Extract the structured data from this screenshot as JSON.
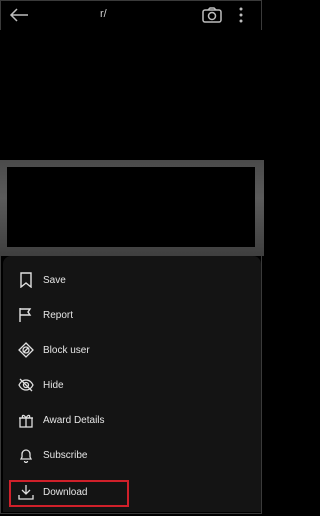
{
  "header": {
    "title": "r/",
    "icons": [
      "back-arrow-icon",
      "camera-icon",
      "more-vertical-icon"
    ]
  },
  "menu": {
    "items": [
      {
        "label": "Save",
        "icon": "bookmark-icon"
      },
      {
        "label": "Report",
        "icon": "flag-icon"
      },
      {
        "label": "Block user",
        "icon": "block-icon"
      },
      {
        "label": "Hide",
        "icon": "eye-off-icon"
      },
      {
        "label": "Award Details",
        "icon": "award-icon"
      },
      {
        "label": "Subscribe",
        "icon": "bell-icon"
      },
      {
        "label": "Download",
        "icon": "download-icon"
      }
    ],
    "highlight_color": "#d0202a"
  }
}
